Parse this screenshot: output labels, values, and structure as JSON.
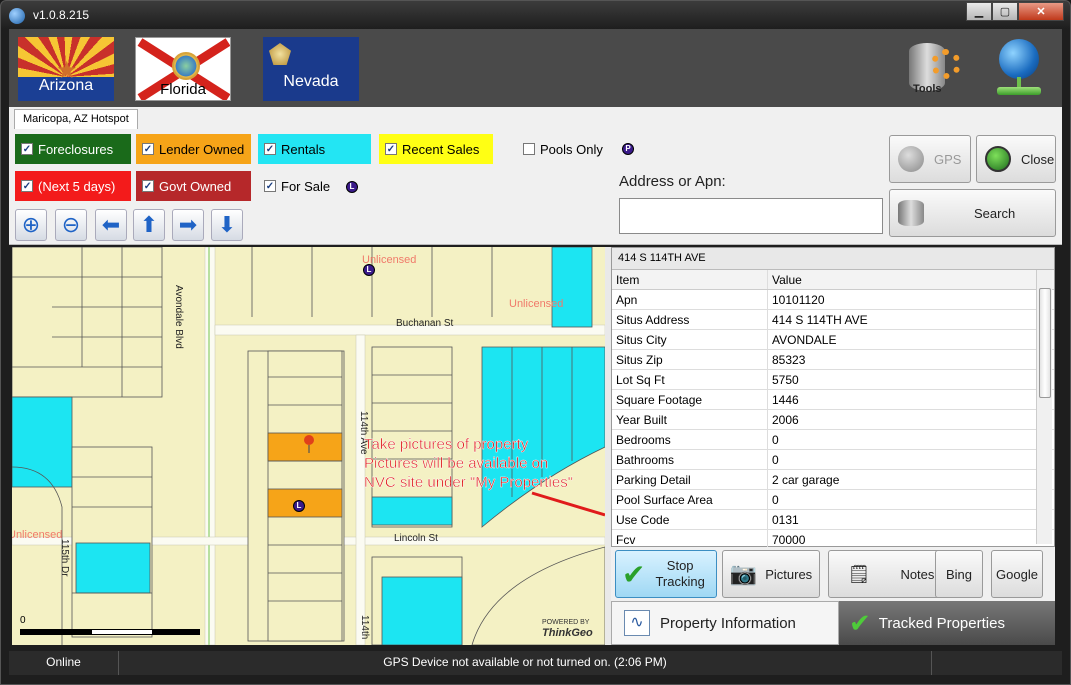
{
  "window": {
    "title": "v1.0.8.215"
  },
  "header": {
    "flags": [
      {
        "label": "Arizona"
      },
      {
        "label": "Florida"
      },
      {
        "label": "Nevada"
      }
    ],
    "tools_label": "Tools"
  },
  "tabs": [
    {
      "label": "Maricopa, AZ Hotspot"
    }
  ],
  "filters": {
    "foreclosures": "Foreclosures",
    "lender_owned": "Lender Owned",
    "rentals": "Rentals",
    "recent_sales": "Recent Sales",
    "pools_only": "Pools Only",
    "next_5_days": "(Next 5 days)",
    "govt_owned": "Govt Owned",
    "for_sale": "For Sale",
    "checked_mark": "✓",
    "pool_marker": "P",
    "listing_marker": "L"
  },
  "search": {
    "address_label": "Address or Apn:",
    "address_value": "",
    "gps_label": "GPS",
    "close_label": "Close",
    "search_label": "Search"
  },
  "map": {
    "streets": {
      "avondale": "Avondale Blvd",
      "buchanan": "Buchanan St",
      "ave114": "114th Ave",
      "lincoln": "Lincoln St",
      "dr115": "115th Dr",
      "ave114_bottom": "114th"
    },
    "watermarks": [
      "Unlicensed",
      "Unlicensed",
      "Unlicensed"
    ],
    "scale_zero": "0",
    "powered_by": "POWERED BY",
    "brand": "ThinkGeo",
    "marker_letter": "L",
    "annotation": [
      "Take pictures of property",
      "Pictures will be available on",
      "NVC site under \"My Properties\""
    ]
  },
  "property": {
    "title": "414 S 114TH AVE",
    "columns": [
      "Item",
      "Value"
    ],
    "rows": [
      [
        "Apn",
        "10101120"
      ],
      [
        "Situs Address",
        "414 S 114TH AVE"
      ],
      [
        "Situs City",
        "AVONDALE"
      ],
      [
        "Situs Zip",
        "85323"
      ],
      [
        "Lot Sq Ft",
        "5750"
      ],
      [
        "Square Footage",
        "1446"
      ],
      [
        "Year Built",
        "2006"
      ],
      [
        "Bedrooms",
        "0"
      ],
      [
        "Bathrooms",
        "0"
      ],
      [
        "Parking Detail",
        "2 car garage"
      ],
      [
        "Pool Surface Area",
        "0"
      ],
      [
        "Use Code",
        "0131"
      ],
      [
        "Fcv",
        "70000"
      ]
    ]
  },
  "actions": {
    "stop_tracking": [
      "Stop",
      "Tracking"
    ],
    "pictures": "Pictures",
    "notes": "Notes",
    "bing": "Bing",
    "google": "Google"
  },
  "bottom_tabs": {
    "property_information": "Property Information",
    "tracked_properties": "Tracked Properties"
  },
  "status": {
    "connection": "Online",
    "message": "GPS Device not available or not turned on. (2:06 PM)"
  },
  "colors": {
    "foreclosures": "#1a6a1a",
    "lender_owned": "#f6a418",
    "rentals": "#23e5f3",
    "recent_sales": "#ffff14",
    "next_5_days": "#f31b1b",
    "govt_owned": "#b6282a",
    "annotation": "#e01b1b"
  }
}
